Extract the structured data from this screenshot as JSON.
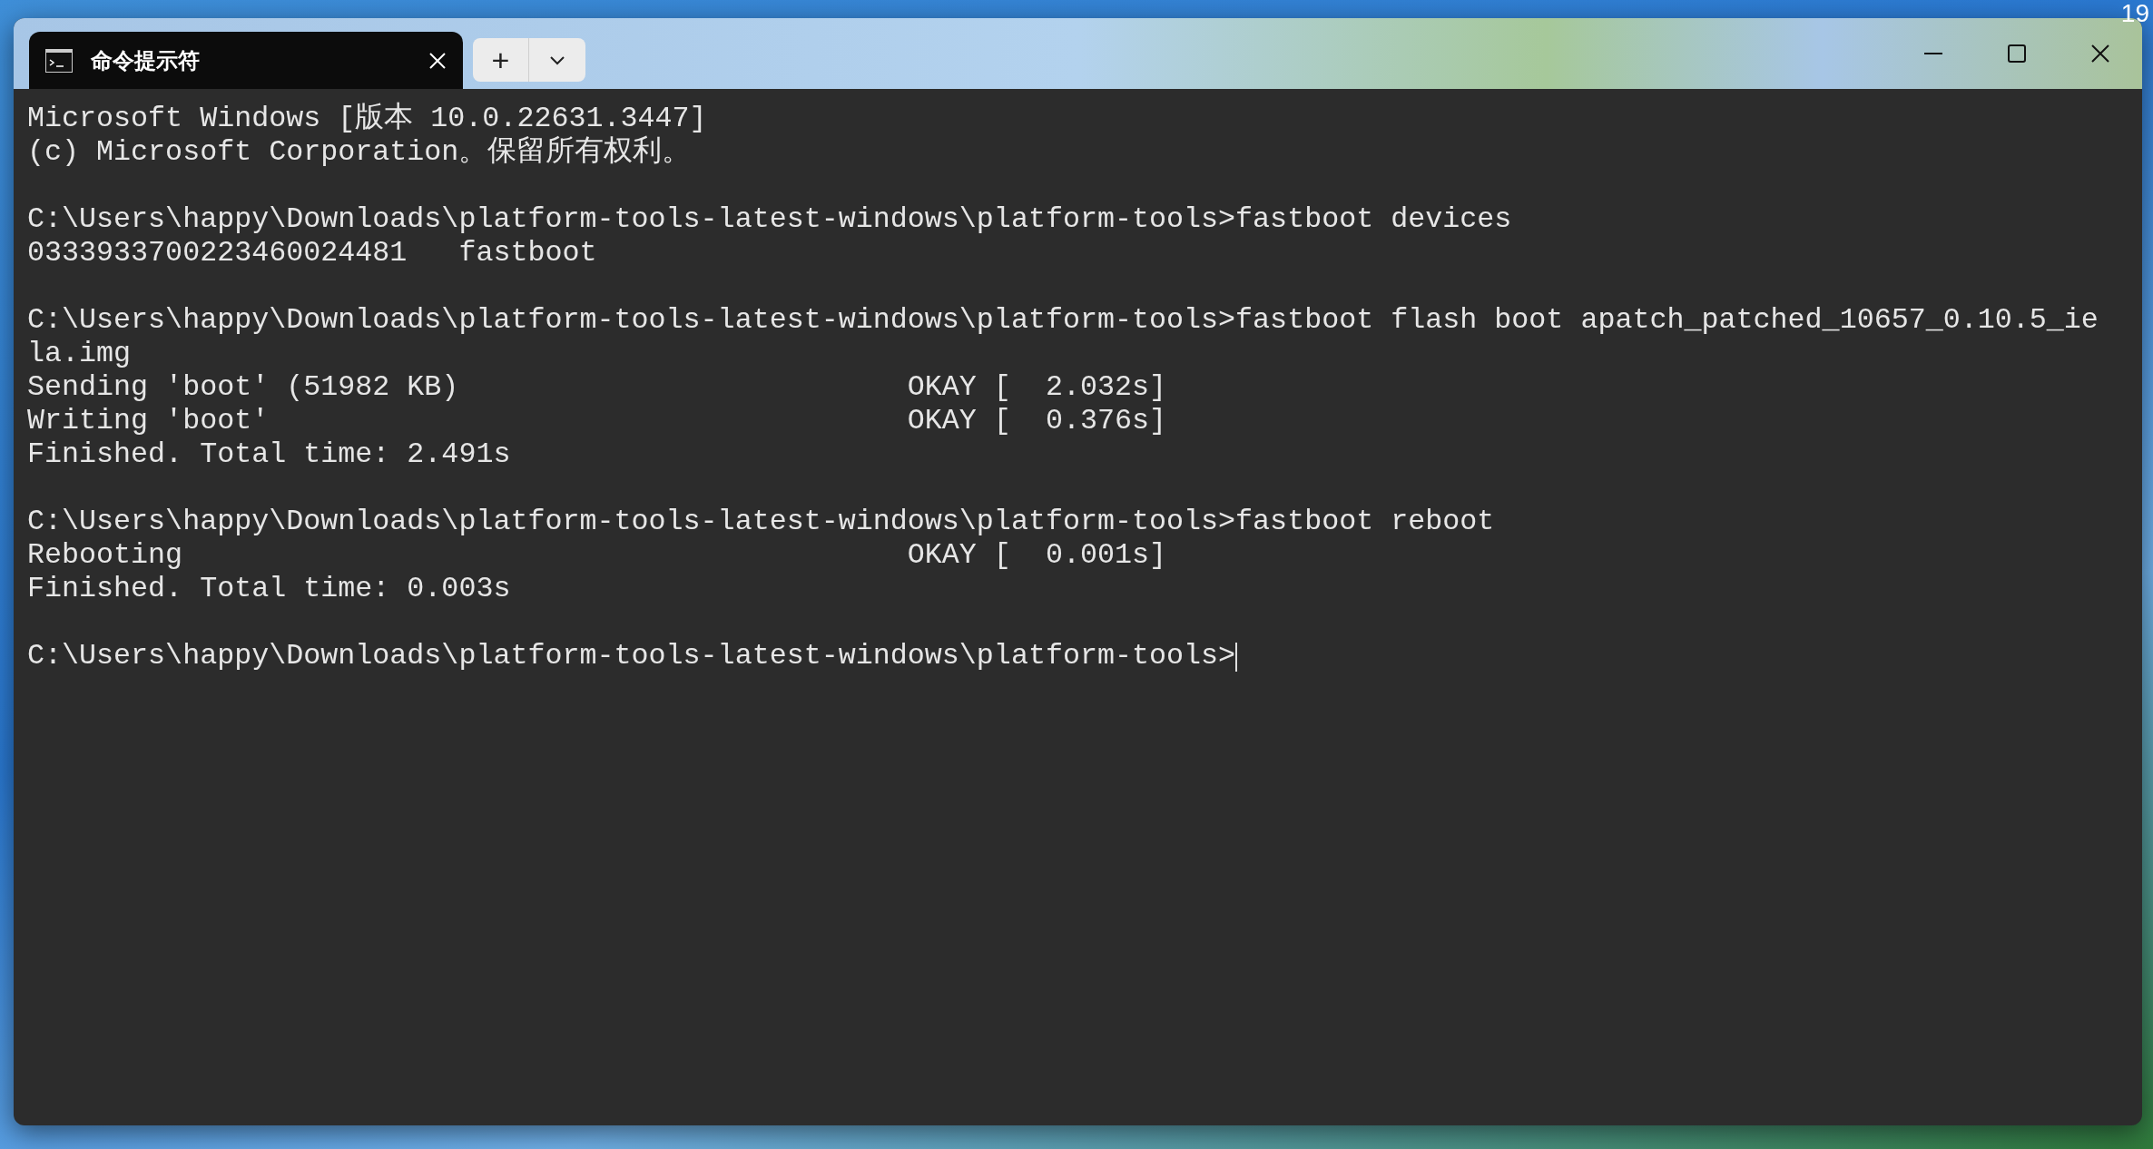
{
  "desktop": {
    "clock_fragment": "19"
  },
  "tab": {
    "title": "命令提示符",
    "selected": true
  },
  "new_tab": {
    "label": "+"
  },
  "lines": [
    {
      "kind": "text",
      "text": "Microsoft Windows [版本 10.0.22631.3447]"
    },
    {
      "kind": "text",
      "text": "(c) Microsoft Corporation。保留所有权利。"
    },
    {
      "kind": "blank"
    },
    {
      "kind": "text",
      "text": "C:\\Users\\happy\\Downloads\\platform-tools-latest-windows\\platform-tools>fastboot devices"
    },
    {
      "kind": "text",
      "text": "0333933700223460024481   fastboot"
    },
    {
      "kind": "blank"
    },
    {
      "kind": "text",
      "text": "C:\\Users\\happy\\Downloads\\platform-tools-latest-windows\\platform-tools>fastboot flash boot apatch_patched_10657_0.10.5_ie"
    },
    {
      "kind": "text",
      "text": "la.img"
    },
    {
      "kind": "text",
      "text": "Sending 'boot' (51982 KB)                          OKAY [  2.032s]"
    },
    {
      "kind": "text",
      "text": "Writing 'boot'                                     OKAY [  0.376s]"
    },
    {
      "kind": "text",
      "text": "Finished. Total time: 2.491s"
    },
    {
      "kind": "blank"
    },
    {
      "kind": "text",
      "text": "C:\\Users\\happy\\Downloads\\platform-tools-latest-windows\\platform-tools>fastboot reboot"
    },
    {
      "kind": "text",
      "text": "Rebooting                                          OKAY [  0.001s]"
    },
    {
      "kind": "text",
      "text": "Finished. Total time: 0.003s"
    },
    {
      "kind": "blank"
    },
    {
      "kind": "prompt",
      "text": "C:\\Users\\happy\\Downloads\\platform-tools-latest-windows\\platform-tools>",
      "cursor": true
    }
  ]
}
